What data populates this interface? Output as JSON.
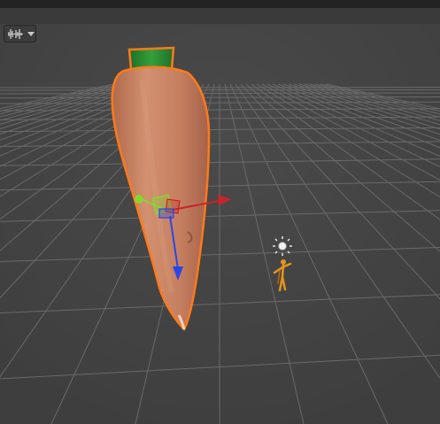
{
  "app": {
    "panel": "Scene view"
  },
  "toolbar": {
    "draw_mode_icon": "audio-waveform-icon",
    "dropdown_icon": "chevron-down-icon"
  },
  "scene": {
    "background_color": "#454545",
    "grid_color": "#6b6b6b",
    "selected_object": {
      "name": "carrot",
      "body_color": "#c98360",
      "leaf_color": "#2e8a34",
      "outline_color": "#ff7a1a"
    },
    "gizmo": {
      "x_axis_color": "#c8242a",
      "y_axis_color": "#86d630",
      "z_axis_color": "#2a47e6"
    },
    "light_icon": "sun-light-icon",
    "character_icon": "humanoid-figure-icon"
  }
}
